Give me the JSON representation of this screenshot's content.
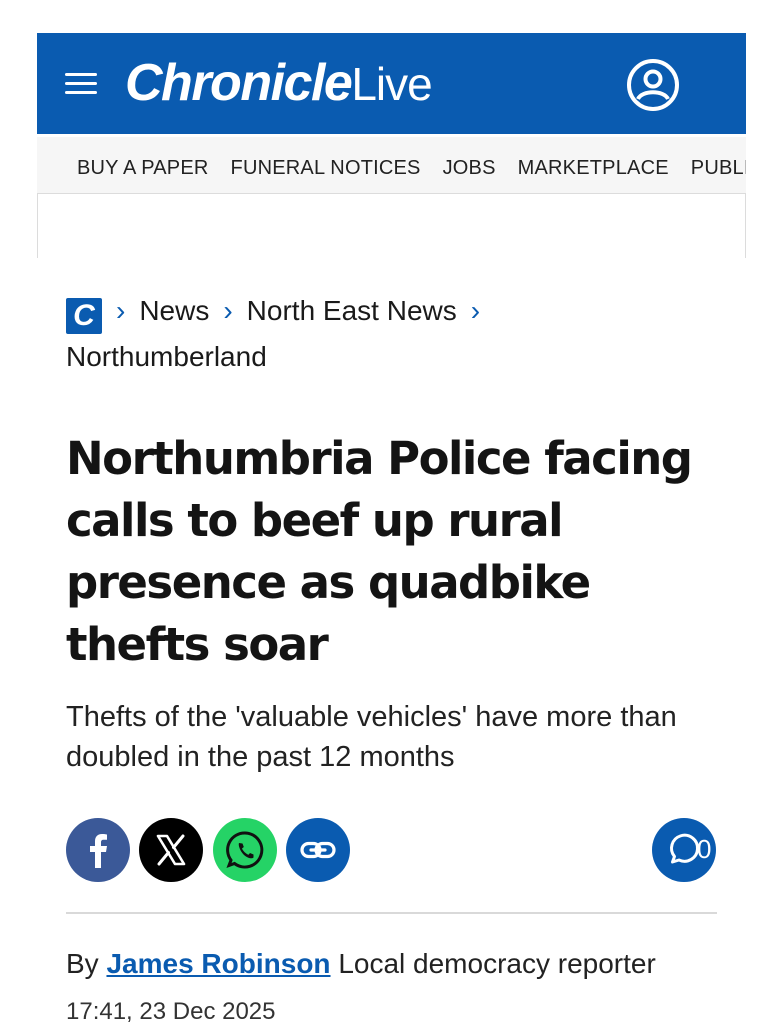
{
  "masthead": {
    "logo_bold": "Chronicle",
    "logo_light": "Live"
  },
  "nav": {
    "items": [
      "BUY A PAPER",
      "FUNERAL NOTICES",
      "JOBS",
      "MARKETPLACE",
      "PUBLIC N"
    ]
  },
  "breadcrumb": {
    "logo_letter": "C",
    "items": [
      "News",
      "North East News",
      "Northumberland"
    ]
  },
  "article": {
    "headline": "Northumbria Police facing calls to beef up rural presence as quadbike thefts soar",
    "standfirst": "Thefts of the 'valuable vehicles' have more than doubled in the past 12 months",
    "comment_count": "0",
    "byline_prefix": "By",
    "author": "James Robinson",
    "author_role": "Local democracy reporter",
    "date": "17:41, 23 Dec 2025"
  },
  "share": {
    "icons": [
      "facebook-icon",
      "x-icon",
      "whatsapp-icon",
      "link-icon"
    ],
    "colors": {
      "facebook": "#3b5998",
      "x": "#000000",
      "whatsapp": "#25d366",
      "link": "#0a5bb0"
    }
  },
  "colors": {
    "brand": "#0a5bb0"
  }
}
